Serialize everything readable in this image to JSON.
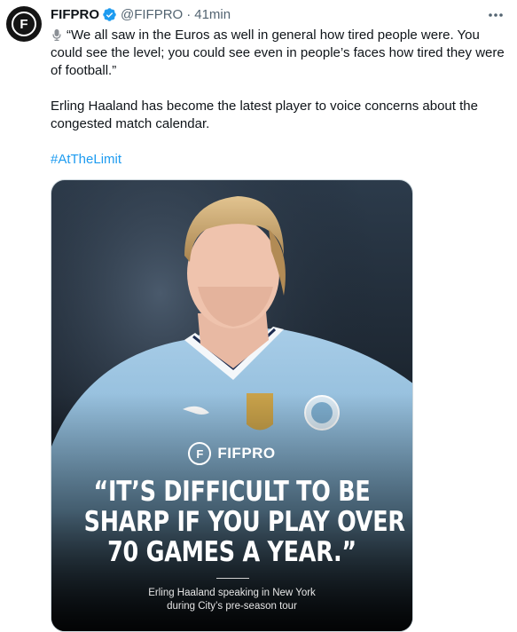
{
  "author": {
    "name": "FIFPRO",
    "handle": "@FIFPRO",
    "separator": "·",
    "time": "41min",
    "avatar_letter": "F"
  },
  "icons": {
    "verified": "verified-badge-icon",
    "more": "more-options-icon",
    "mic": "microphone-icon"
  },
  "colors": {
    "link": "#1d9bf0",
    "verified": "#1d9bf0",
    "secondary_text": "#536471"
  },
  "tweet": {
    "quote": "“We all saw in the Euros as well in general how tired people were. You could see the level; you could see even in people’s faces how tired they were of football.”",
    "body": "Erling Haaland has become the latest player to voice concerns about the congested match calendar.",
    "hashtag": "#AtTheLimit"
  },
  "media": {
    "brand_letter": "F",
    "brand_name": "FIFPRO",
    "quote_lines": [
      "“IT’S DIFFICULT TO BE",
      "SHARP IF YOU PLAY OVER",
      "70 GAMES A YEAR.”"
    ],
    "caption_lines": [
      "Erling Haaland speaking in New York",
      "during City’s pre-season tour"
    ]
  }
}
